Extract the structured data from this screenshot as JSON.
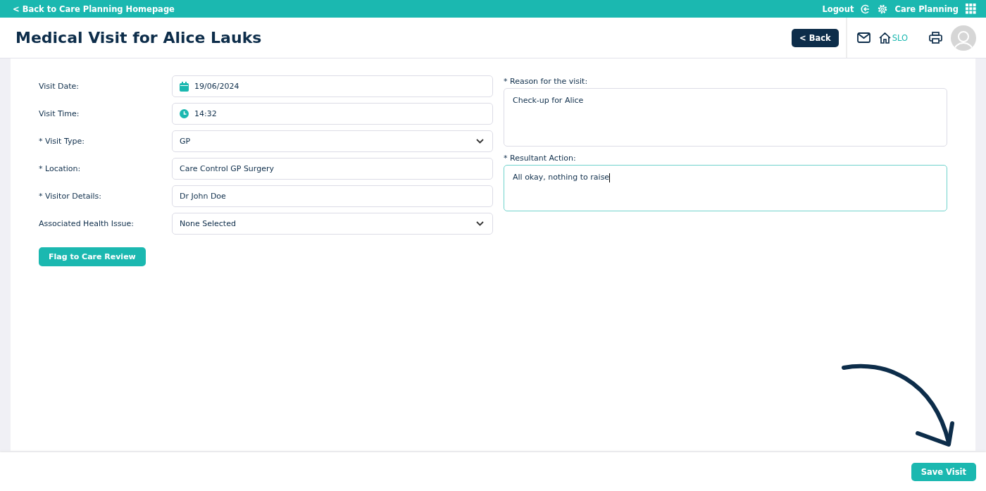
{
  "top_bar": {
    "back_link": "< Back to Care Planning Homepage",
    "logout": "Logout",
    "app_name": "Care Planning"
  },
  "header": {
    "title": "Medical Visit for Alice Lauks",
    "back_button": "< Back",
    "home_label": "SLO"
  },
  "form": {
    "fields": [
      {
        "label": "Visit Date:",
        "kind": "date",
        "value": "19/06/2024"
      },
      {
        "label": "Visit Time:",
        "kind": "time",
        "value": "14:32"
      },
      {
        "label": "* Visit Type:",
        "kind": "select",
        "value": "GP"
      },
      {
        "label": "* Location:",
        "kind": "text",
        "value": "Care Control GP Surgery"
      },
      {
        "label": "* Visitor Details:",
        "kind": "text",
        "value": "Dr John Doe"
      },
      {
        "label": "Associated Health Issue:",
        "kind": "select",
        "value": "None Selected"
      }
    ],
    "flag_button": "Flag to Care Review",
    "text_areas": [
      {
        "label": "* Reason for the visit:",
        "value": "Check-up for Alice",
        "focused": false
      },
      {
        "label": "* Resultant Action:",
        "value": "All okay, nothing to raise",
        "focused": true
      }
    ]
  },
  "footer": {
    "save_button": "Save Visit"
  }
}
